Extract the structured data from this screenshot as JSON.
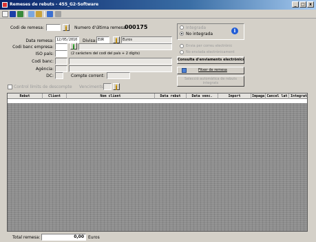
{
  "window": {
    "title": "Remeses de rebuts - 455_G2-Software",
    "controls": [
      "_",
      "□",
      "x"
    ]
  },
  "toolbar": {
    "icons": [
      "new-icon",
      "save-icon",
      "print-icon",
      "preview-icon",
      "refresh-icon",
      "undo-icon",
      "help-icon"
    ]
  },
  "form": {
    "codi_remesa_label": "Codi de remesa:",
    "codi_remesa_value": "",
    "numero_ultima_label": "Numero d'última remesa:",
    "numero_ultima_value": "000175",
    "data_remesa_label": "Data remesa:",
    "data_remesa_value": "12/05/2010",
    "divisa_label": "Divisa:",
    "divisa_code": "EUR",
    "divisa_name": "Euros",
    "codi_banc_label": "Codi banc empresa:",
    "codi_banc_value": "",
    "iso_pais_label": "ISO país:",
    "iso_pais_value": "",
    "iso_pais_hint": "(2 caràcters del codi del país + 2 dígits)",
    "codi_banc2_label": "Codi banc:",
    "agencia_label": "Agència:",
    "dc_label": "DC:",
    "compte_corrent_label": "Compte corrent:",
    "control_label": "Control límits de descompte",
    "venciments_label": "Venciments:"
  },
  "status_panel": {
    "option1": "Integrada",
    "option2": "No integrada",
    "selected": "No integrada"
  },
  "envio_panel": {
    "option1": "Envia per correu electrònic",
    "option2": "No enviada electrònicament",
    "consulta_button": "Consulta d'enviaments electrònics",
    "fitxer_button": "Fitxer de remesa",
    "selecciona_button": "Selecció automàtica de rebuts integrats"
  },
  "grid": {
    "columns": [
      "Rebut",
      "Client",
      "Nom client",
      "Data rebut",
      "Data venc.",
      "Import",
      "Impaga",
      "Cancel lat",
      "Integrat"
    ]
  },
  "footer": {
    "total_label": "Total remesa:",
    "total_value": "0,00",
    "currency": "Euros"
  }
}
